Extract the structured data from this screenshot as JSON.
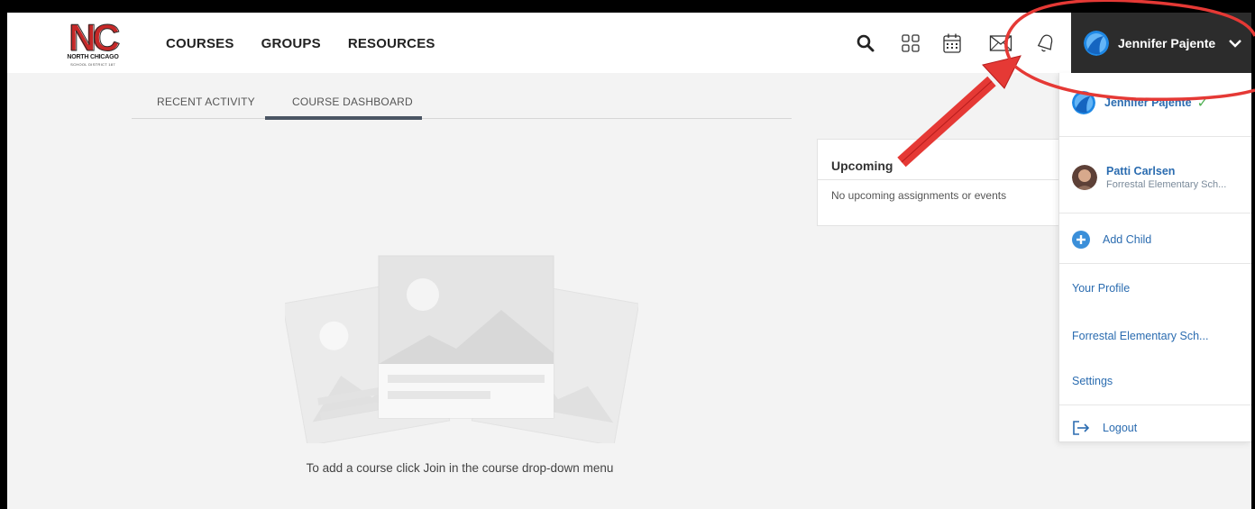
{
  "logo": {
    "mark": "NC",
    "line1": "NORTH CHICAGO",
    "line2": "SCHOOL DISTRICT 187",
    "brand_color": "#c62828"
  },
  "nav": {
    "courses": "COURSES",
    "groups": "GROUPS",
    "resources": "RESOURCES"
  },
  "header_icons": [
    "search-icon",
    "apps-grid-icon",
    "calendar-icon",
    "mail-icon",
    "bell-icon"
  ],
  "user": {
    "name": "Jennifer Pajente"
  },
  "tabs": {
    "recent": "RECENT ACTIVITY",
    "dashboard": "COURSE DASHBOARD",
    "active": "COURSE DASHBOARD"
  },
  "upcoming": {
    "title": "Upcoming",
    "empty": "No upcoming assignments or events"
  },
  "empty_state": {
    "message": "To add a course click Join in the course drop-down menu"
  },
  "dropdown": {
    "current_user": "Jennifer Pajente",
    "child": {
      "name": "Patti Carlsen",
      "school": "Forrestal Elementary Sch..."
    },
    "add_child": "Add Child",
    "profile": "Your Profile",
    "school": "Forrestal Elementary Sch...",
    "settings": "Settings",
    "logout": "Logout"
  },
  "colors": {
    "header_bg": "#ffffff",
    "user_menu_bg": "#2c2c2c",
    "link": "#2b6cb0",
    "annotation": "#e53935",
    "page_bg": "#f3f3f3"
  }
}
